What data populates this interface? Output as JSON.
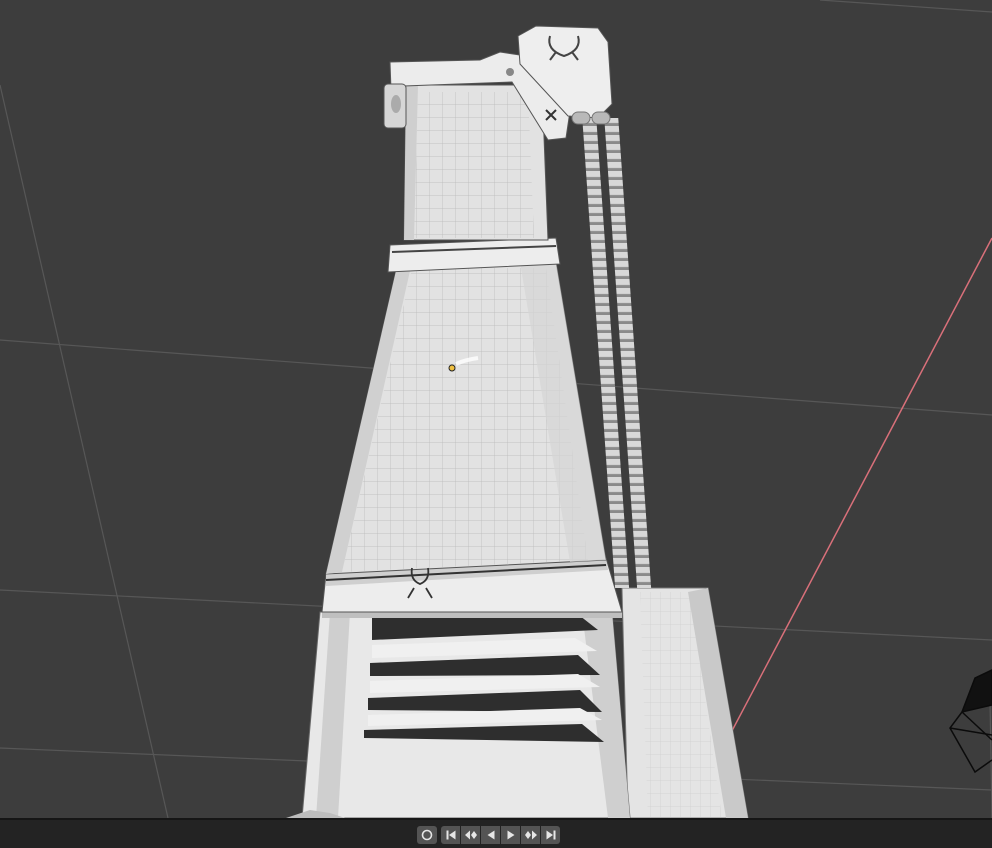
{
  "viewport": {
    "background": "#3d3d3d",
    "grid_line_color": "#555555",
    "x_axis_color": "#d9707a",
    "model_color": "#e6e6e6",
    "active_object_origin_color": "#f0c040"
  },
  "playback": {
    "buttons": [
      {
        "name": "record-button",
        "icon": "record-icon"
      },
      {
        "name": "jump-to-start-button",
        "icon": "jump-start-icon"
      },
      {
        "name": "jump-to-keyframe-prev-button",
        "icon": "keyframe-prev-icon"
      },
      {
        "name": "play-reverse-button",
        "icon": "play-reverse-icon"
      },
      {
        "name": "play-button",
        "icon": "play-icon"
      },
      {
        "name": "jump-to-keyframe-next-button",
        "icon": "keyframe-next-icon"
      },
      {
        "name": "jump-to-end-button",
        "icon": "jump-end-icon"
      }
    ]
  }
}
